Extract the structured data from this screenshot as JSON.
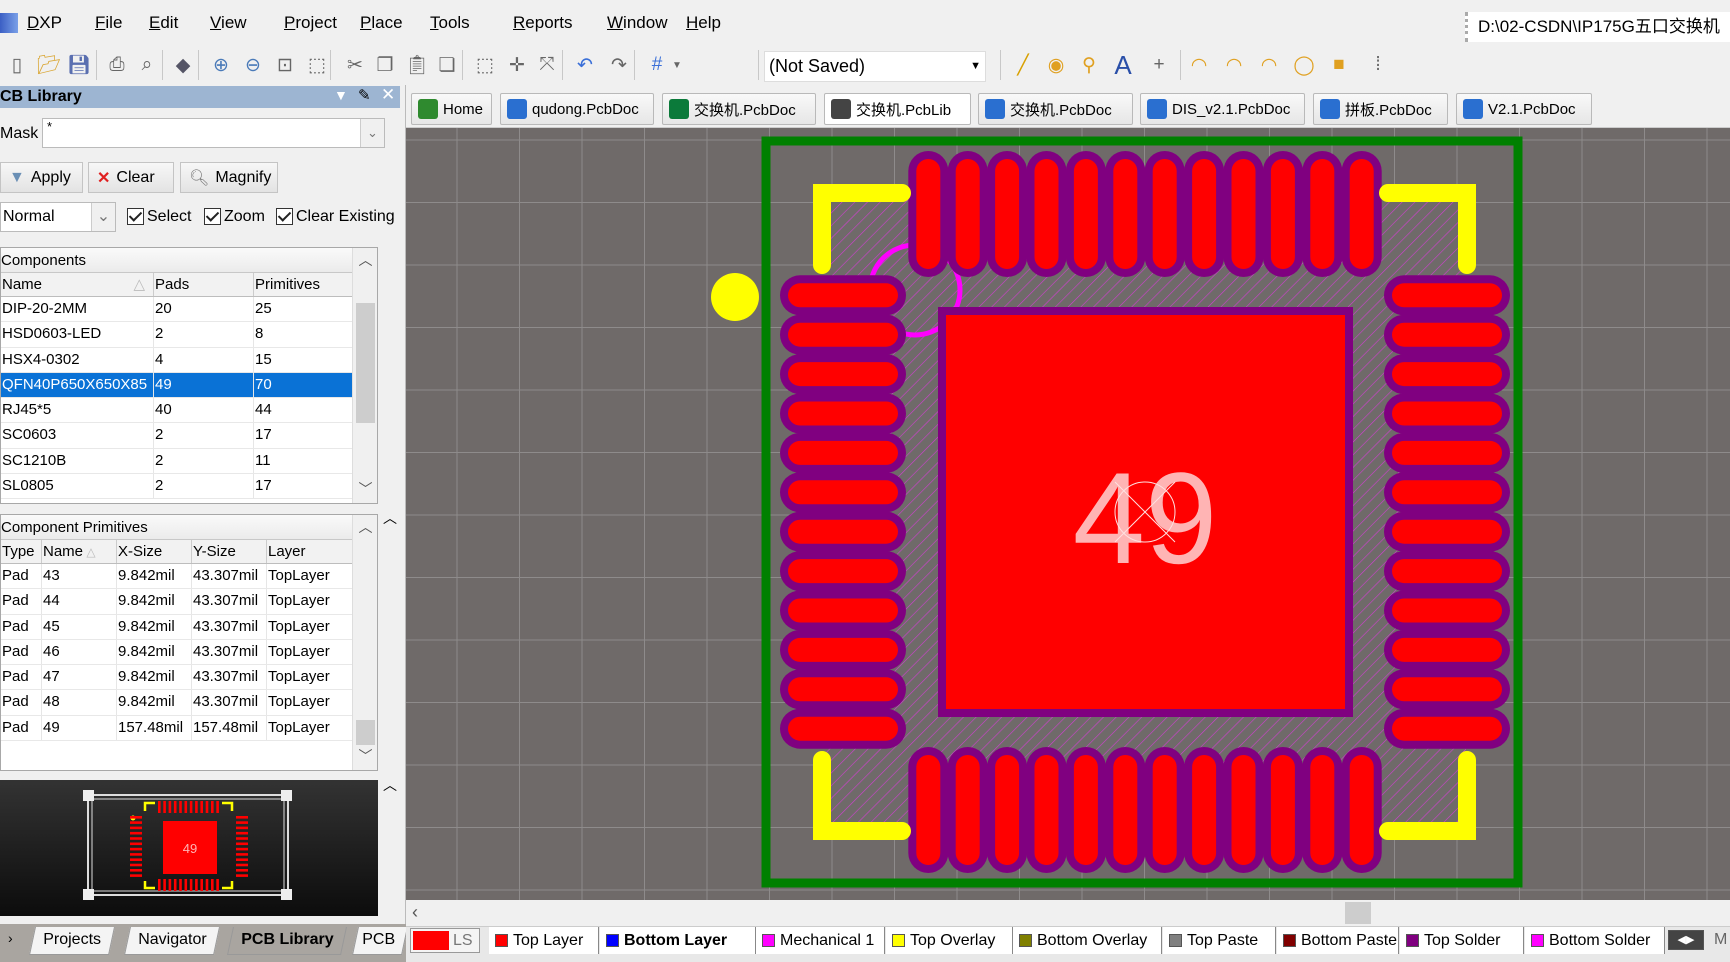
{
  "menu": {
    "app": "DXP",
    "items": [
      "File",
      "Edit",
      "View",
      "Project",
      "Place",
      "Tools",
      "Reports",
      "Window",
      "Help"
    ],
    "path": "D:\\02-CSDN\\IP175G五口交换机"
  },
  "toolbar": {
    "combo_value": "(Not Saved)",
    "icons": [
      "new-file",
      "open-folder",
      "save",
      "print",
      "print-preview",
      "3d-view",
      "zoom-in",
      "zoom-out",
      "zoom-fit",
      "zoom-area",
      "cut",
      "copy",
      "paste",
      "paste-special",
      "select-rect",
      "move",
      "deselect",
      "undo",
      "redo",
      "grid",
      "line",
      "pad",
      "via",
      "string",
      "coordinate",
      "arc-center",
      "arc-edge",
      "arc-any",
      "full-circle",
      "fill",
      "array"
    ]
  },
  "doc_tabs": [
    {
      "label": "Home",
      "icon": "home-icon",
      "active": false
    },
    {
      "label": "qudong.PcbDoc",
      "icon": "pcbdoc-icon",
      "active": false
    },
    {
      "label": "交换机.PcbDoc",
      "icon": "pcb-board-icon",
      "active": false
    },
    {
      "label": "交换机.PcbLib",
      "icon": "pcblib-icon",
      "active": true
    },
    {
      "label": "交换机.PcbDoc",
      "icon": "pcbdoc-icon",
      "active": false
    },
    {
      "label": "DIS_v2.1.PcbDoc",
      "icon": "pcbdoc-icon",
      "active": false
    },
    {
      "label": "拼板.PcbDoc",
      "icon": "pcbdoc-icon",
      "active": false
    },
    {
      "label": "V2.1.PcbDoc",
      "icon": "pcbdoc-icon",
      "active": false
    }
  ],
  "panel": {
    "title": "CB Library",
    "mask_label": "Mask",
    "mask_value": "*",
    "apply": "Apply",
    "clear": "Clear",
    "magnify": "Magnify",
    "mode": "Normal",
    "checks": [
      {
        "label": "Select",
        "checked": true
      },
      {
        "label": "Zoom",
        "checked": true
      },
      {
        "label": "Clear Existing",
        "checked": true
      }
    ],
    "components": {
      "title": "Components",
      "columns": [
        "Name",
        "Pads",
        "Primitives"
      ],
      "rows": [
        [
          "DIP-20-2MM",
          "20",
          "25"
        ],
        [
          "HSD0603-LED",
          "2",
          "8"
        ],
        [
          "HSX4-0302",
          "4",
          "15"
        ],
        [
          "QFN40P650X650X85",
          "49",
          "70"
        ],
        [
          "RJ45*5",
          "40",
          "44"
        ],
        [
          "SC0603",
          "2",
          "17"
        ],
        [
          "SC1210B",
          "2",
          "11"
        ],
        [
          "SL0805",
          "2",
          "17"
        ]
      ],
      "selected": 3
    },
    "primitives": {
      "title": "Component Primitives",
      "columns": [
        "Type",
        "Name",
        "X-Size",
        "Y-Size",
        "Layer"
      ],
      "rows": [
        [
          "Pad",
          "43",
          "9.842mil",
          "43.307mil",
          "TopLayer"
        ],
        [
          "Pad",
          "44",
          "9.842mil",
          "43.307mil",
          "TopLayer"
        ],
        [
          "Pad",
          "45",
          "9.842mil",
          "43.307mil",
          "TopLayer"
        ],
        [
          "Pad",
          "46",
          "9.842mil",
          "43.307mil",
          "TopLayer"
        ],
        [
          "Pad",
          "47",
          "9.842mil",
          "43.307mil",
          "TopLayer"
        ],
        [
          "Pad",
          "48",
          "9.842mil",
          "43.307mil",
          "TopLayer"
        ],
        [
          "Pad",
          "49",
          "157.48mil",
          "157.48mil",
          "TopLayer"
        ]
      ]
    },
    "bottom_tabs": [
      "Projects",
      "Navigator",
      "PCB Library",
      "PCB"
    ],
    "active_bottom_tab": "PCB Library"
  },
  "footprint": {
    "pads_per_side": 12,
    "center_pad_label": "49",
    "colors": {
      "pad": "#ff0000",
      "solder_mask": "#800080",
      "overlay": "#ffff00",
      "mechanical": "#ff00ff",
      "board_outline": "#008000",
      "canvas": "#6f6a69",
      "grid": "#8e8b8b",
      "pad_label": "#ffb4b4"
    }
  },
  "layers": {
    "current_label": "LS",
    "current_color": "#ff0000",
    "tabs": [
      {
        "label": "Top Layer",
        "color": "#ff0000",
        "bold": false
      },
      {
        "label": "Bottom Layer",
        "color": "#0000ff",
        "bold": true
      },
      {
        "label": "Mechanical 1",
        "color": "#ff00ff",
        "bold": false
      },
      {
        "label": "Top Overlay",
        "color": "#ffff00",
        "bold": false
      },
      {
        "label": "Bottom Overlay",
        "color": "#808000",
        "bold": false
      },
      {
        "label": "Top Paste",
        "color": "#808080",
        "bold": false
      },
      {
        "label": "Bottom Paste",
        "color": "#800000",
        "bold": false
      },
      {
        "label": "Top Solder",
        "color": "#800080",
        "bold": false
      },
      {
        "label": "Bottom Solder",
        "color": "#ff00ff",
        "bold": false
      }
    ],
    "overflow_label": "M"
  }
}
